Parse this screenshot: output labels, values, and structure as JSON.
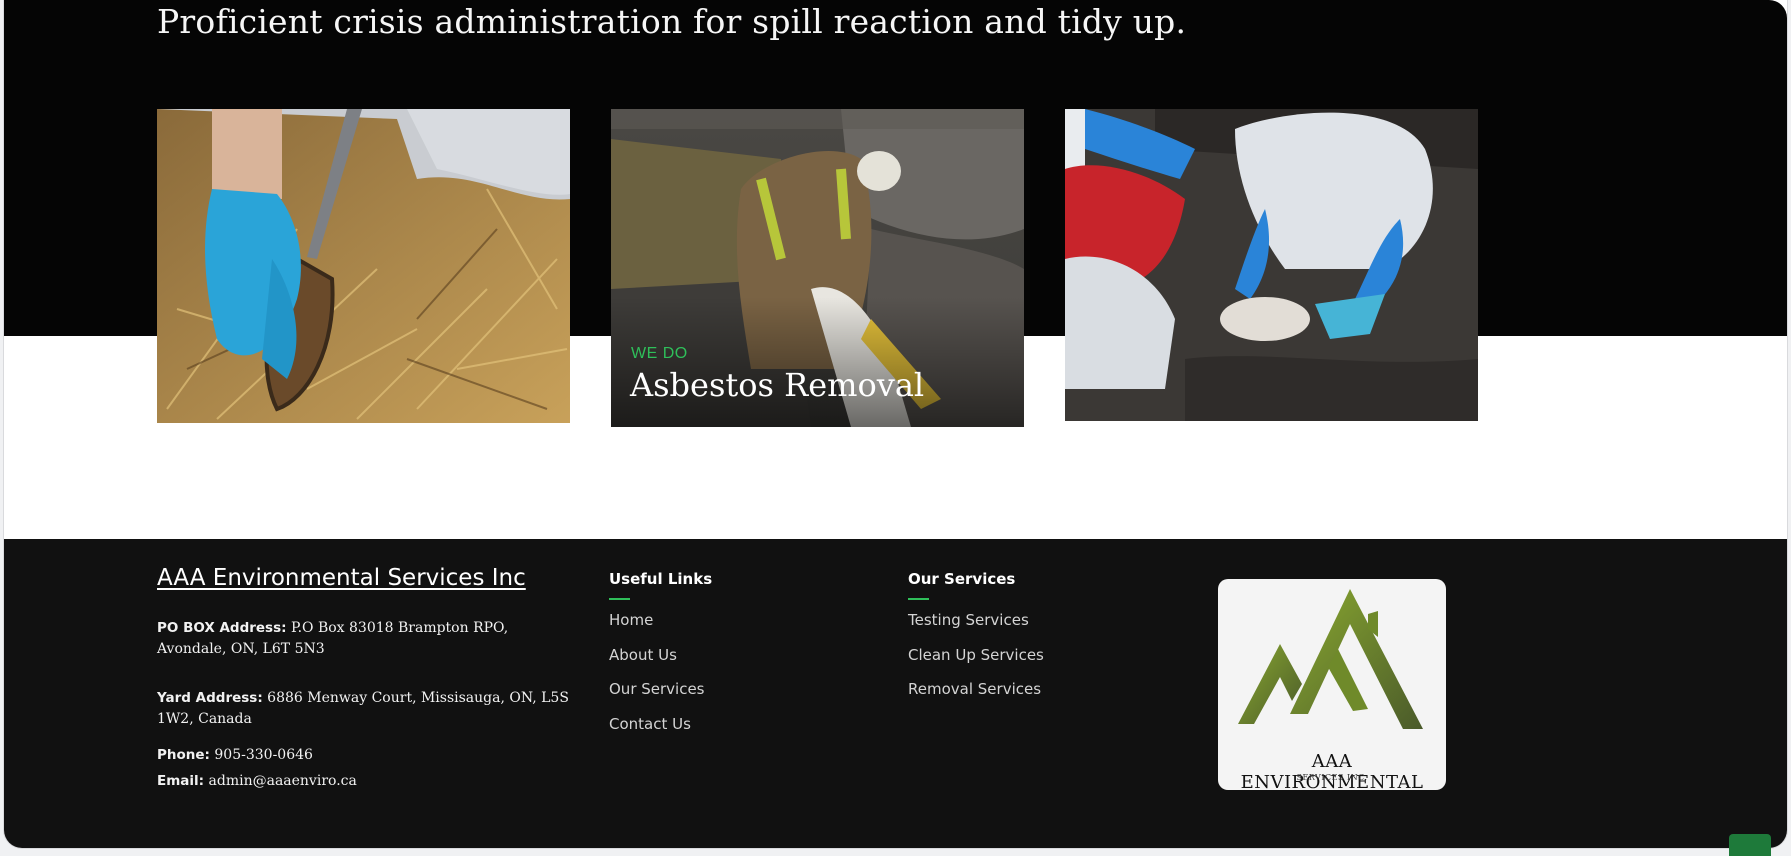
{
  "hero": {
    "title": "Proficient crisis administration for spill reaction and tidy up."
  },
  "cards": [
    {
      "image": "soil-sampling-photo",
      "kicker": "",
      "title": ""
    },
    {
      "image": "asbestos-worker-photo",
      "kicker": "WE DO",
      "title": "Asbestos Removal"
    },
    {
      "image": "spill-cleanup-photo",
      "kicker": "",
      "title": ""
    }
  ],
  "footer": {
    "company": "AAA Environmental Services Inc",
    "po_box_label": "PO BOX Address:",
    "po_box_value": " P.O Box 83018 Brampton RPO, Avondale, ON, L6T 5N3",
    "yard_label": "Yard Address:",
    "yard_value": " 6886 Menway Court, Missisauga, ON, L5S 1W2, Canada",
    "phone_label": "Phone:",
    "phone_value": " 905-330-0646",
    "email_label": "Email:",
    "email_value": " admin@aaaenviro.ca",
    "useful_links": {
      "heading": "Useful Links",
      "items": [
        "Home",
        "About Us",
        "Our Services",
        "Contact Us"
      ]
    },
    "our_services": {
      "heading": "Our Services",
      "items": [
        "Testing Services",
        "Clean Up Services",
        "Removal Services"
      ]
    },
    "logo": {
      "main": "AAA ENVIRONMENTAL",
      "sub": "SERVICES INC.",
      "icon": "mountain-logo-icon"
    }
  },
  "colors": {
    "accent": "#2fbf5a",
    "footer_bg": "#111111",
    "hero_bg": "#050505",
    "logo_green": "#6f8a2a"
  }
}
